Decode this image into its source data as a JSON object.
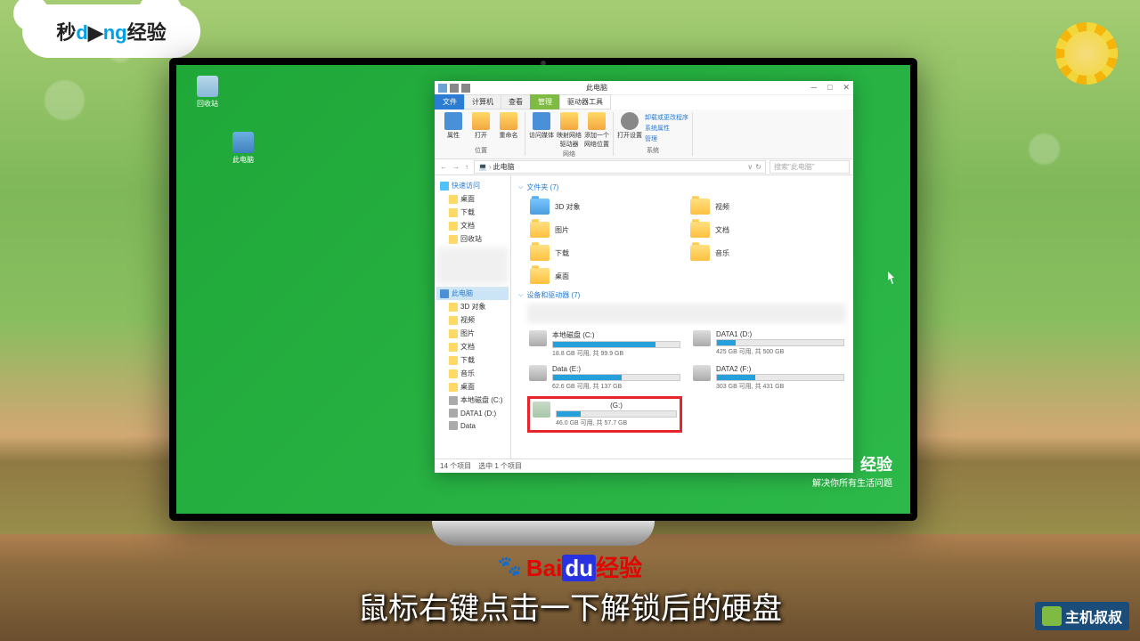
{
  "logo": {
    "part1": "秒",
    "part2": "d",
    "part3": "ng",
    "part4": "经验"
  },
  "desktop": {
    "recycle": "回收站",
    "thispc": "此电脑"
  },
  "explorer": {
    "title": "此电脑",
    "tabs": {
      "file": "文件",
      "computer": "计算机",
      "view": "查看",
      "manage": "管理",
      "drivetools": "驱动器工具"
    },
    "ribbon": {
      "props": "属性",
      "open": "打开",
      "rename": "重命名",
      "media": "访问媒体",
      "mapnet": "映射网络驱动器",
      "addloc": "添加一个网络位置",
      "opensettings": "打开设置",
      "unin": "卸载或更改程序",
      "sysprops": "系统属性",
      "mgmt": "管理",
      "g1": "位置",
      "g2": "网络",
      "g3": "系统"
    },
    "breadcrumb": "此电脑",
    "search": "搜索\"此电脑\"",
    "sidebar": {
      "quick": "快速访问",
      "desktop": "桌面",
      "downloads": "下载",
      "documents": "文档",
      "recycle": "回收站",
      "thispc": "此电脑",
      "obj3d": "3D 对象",
      "videos": "视频",
      "pictures": "图片",
      "docs": "文档",
      "dl": "下载",
      "music": "音乐",
      "desk": "桌面",
      "localc": "本地磁盘 (C:)",
      "data1": "DATA1 (D:)",
      "data": "Data"
    },
    "sections": {
      "folders": "文件夹 (7)",
      "drives": "设备和驱动器 (7)"
    },
    "folders": {
      "obj3d": "3D 对象",
      "videos": "视频",
      "pictures": "图片",
      "documents": "文档",
      "downloads": "下载",
      "music": "音乐",
      "desktop": "桌面"
    },
    "drivesData": {
      "c": {
        "name": "本地磁盘 (C:)",
        "text": "18.8 GB 可用, 共 99.9 GB",
        "pct": 81
      },
      "d": {
        "name": "DATA1 (D:)",
        "text": "425 GB 可用, 共 500 GB",
        "pct": 15
      },
      "e": {
        "name": "Data (E:)",
        "text": "62.6 GB 可用, 共 137 GB",
        "pct": 54
      },
      "f": {
        "name": "DATA2 (F:)",
        "text": "303 GB 可用, 共 431 GB",
        "pct": 30
      },
      "g": {
        "name": "(G:)",
        "text": "46.0 GB 可用, 共 57.7 GB",
        "pct": 20
      }
    },
    "status": "14 个项目　选中 1 个项目"
  },
  "watermark": {
    "t": "经验",
    "s": "解决你所有生活问题"
  },
  "baidu": {
    "bai": "Bai",
    "du": "du",
    "jy": "经验"
  },
  "subtitle": "鼠标右键点击一下解锁后的硬盘",
  "corner": "主机叔叔"
}
